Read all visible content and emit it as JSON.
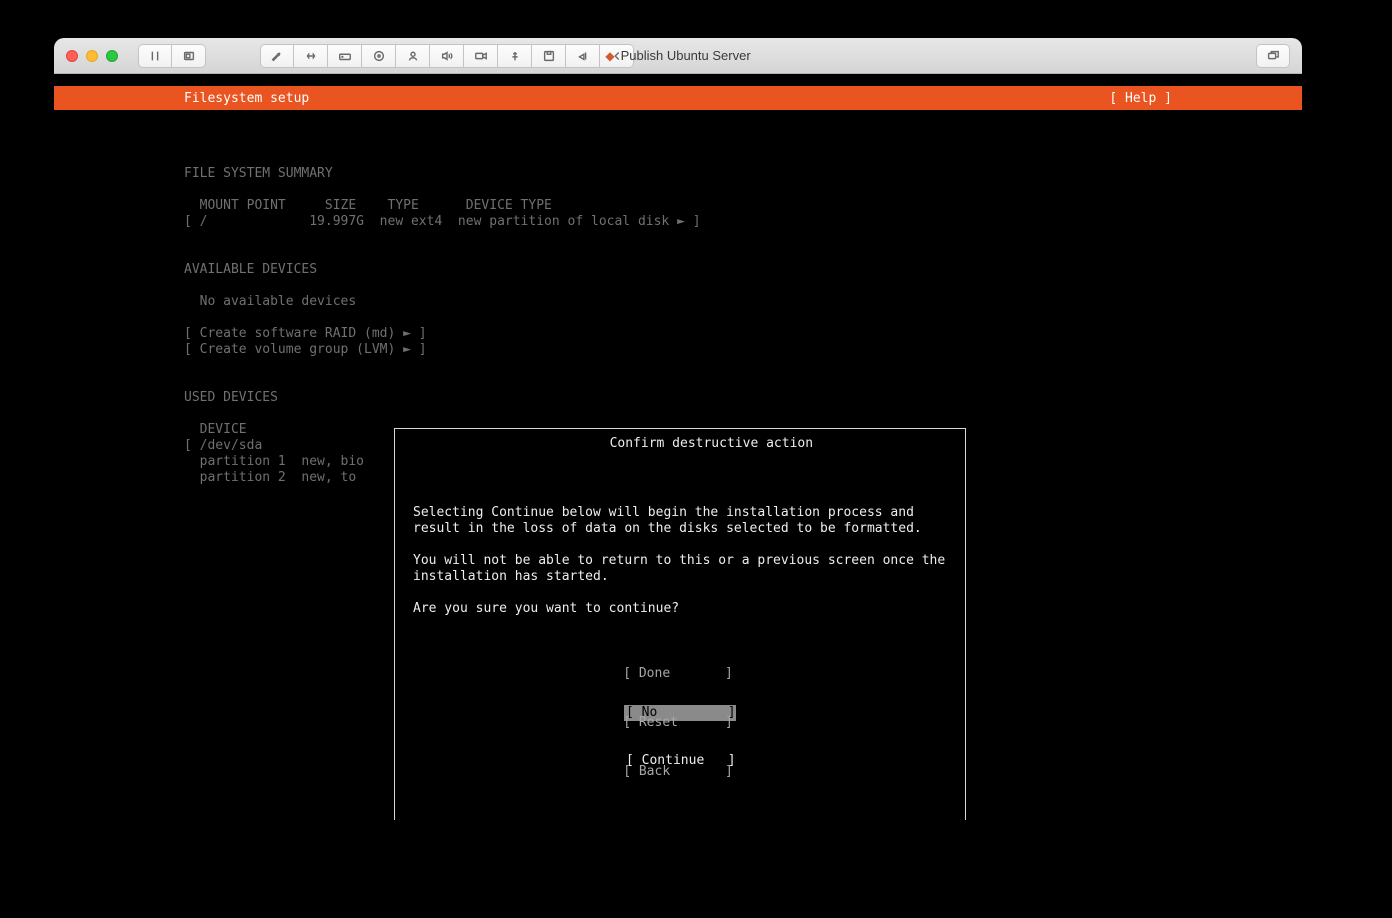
{
  "window": {
    "title": "Publish Ubuntu Server"
  },
  "header": {
    "title": "Filesystem setup",
    "help": "[ Help ]"
  },
  "summary": {
    "heading": "FILE SYSTEM SUMMARY",
    "columns": "  MOUNT POINT     SIZE    TYPE      DEVICE TYPE",
    "row": "[ /             19.997G  new ext4  new partition of local disk ► ]"
  },
  "available": {
    "heading": "AVAILABLE DEVICES",
    "none": "  No available devices",
    "raid": "[ Create software RAID (md) ► ]",
    "lvm": "[ Create volume group (LVM) ► ]"
  },
  "used": {
    "heading": "USED DEVICES",
    "col": "  DEVICE",
    "dev": "[ /dev/sda",
    "p1": "  partition 1  new, bio",
    "p2": "  partition 2  new, to"
  },
  "footer": {
    "done": "[ Done       ]",
    "reset": "[ Reset      ]",
    "back": "[ Back       ]"
  },
  "dialog": {
    "title": "Confirm destructive action",
    "p1": "Selecting Continue below will begin the installation process and result in the loss of data on the disks selected to be formatted.",
    "p2": "You will not be able to return to this or a previous screen once the installation has started.",
    "p3": "Are you sure you want to continue?",
    "no": "[ No         ]",
    "continue": "[ Continue   ]"
  }
}
